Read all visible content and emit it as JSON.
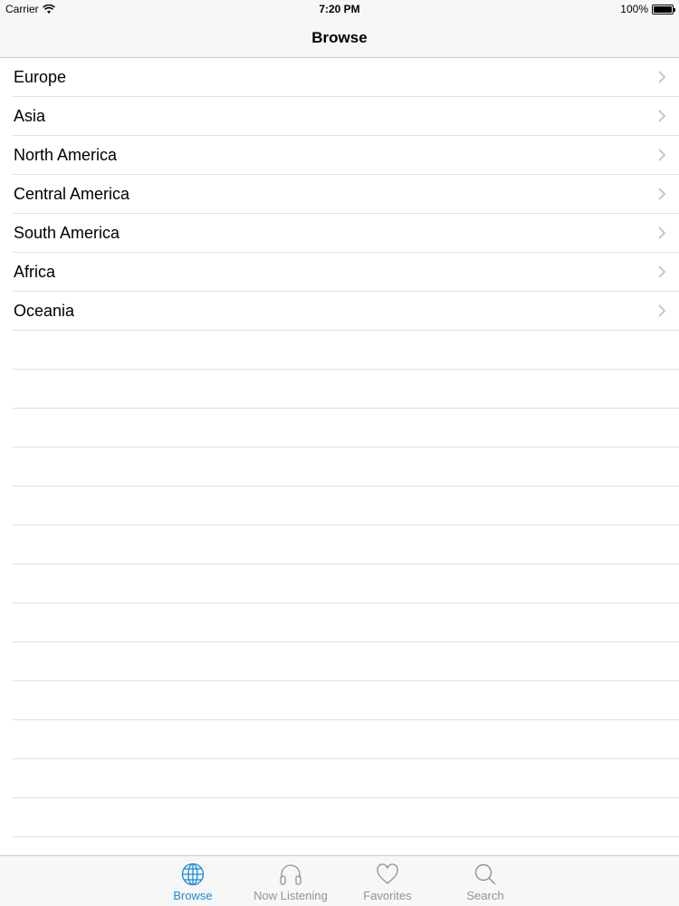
{
  "status": {
    "carrier": "Carrier",
    "time": "7:20 PM",
    "battery": "100%"
  },
  "nav": {
    "title": "Browse"
  },
  "regions": [
    {
      "label": "Europe"
    },
    {
      "label": "Asia"
    },
    {
      "label": "North America"
    },
    {
      "label": "Central America"
    },
    {
      "label": "South America"
    },
    {
      "label": "Africa"
    },
    {
      "label": "Oceania"
    }
  ],
  "tabs": [
    {
      "label": "Browse",
      "icon": "globe-icon",
      "active": true
    },
    {
      "label": "Now Listening",
      "icon": "headphones-icon",
      "active": false
    },
    {
      "label": "Favorites",
      "icon": "heart-icon",
      "active": false
    },
    {
      "label": "Search",
      "icon": "magnifier-icon",
      "active": false
    }
  ],
  "colors": {
    "accent": "#1a8ad6",
    "inactive_tab": "#929292",
    "separator": "#e1e1e4",
    "bar_background": "#f7f7f8"
  }
}
